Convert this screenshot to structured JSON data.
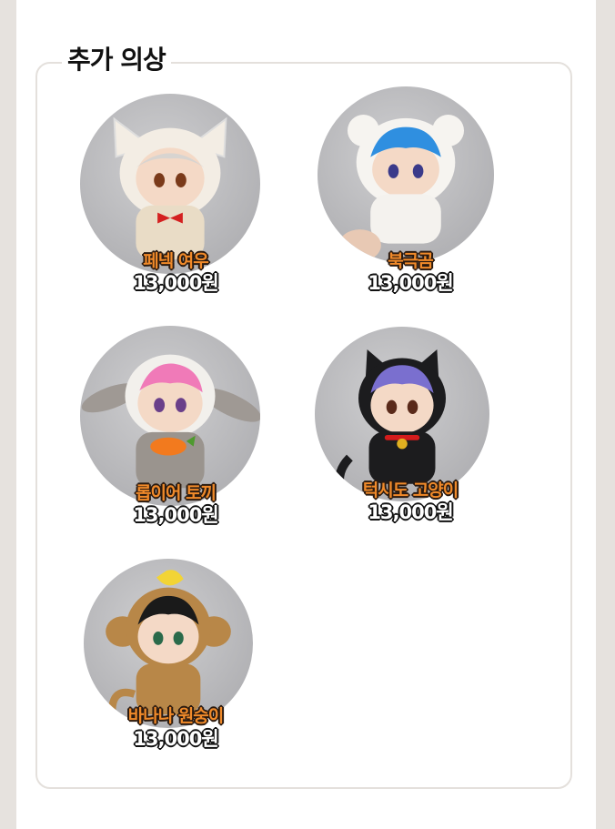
{
  "section": {
    "title": "추가 의상"
  },
  "products": [
    {
      "name": "페넥 여우",
      "price": "13,000원",
      "costume": "fennec-fox",
      "hair": "#d8d4d0",
      "suit": "#efe7da",
      "accent": "#d42020"
    },
    {
      "name": "북극곰",
      "price": "13,000원",
      "costume": "polar-bear",
      "hair": "#2f8fe0",
      "suit": "#f4f2ee",
      "accent": "#e8a9a0"
    },
    {
      "name": "롭이어 토끼",
      "price": "13,000원",
      "costume": "lop-rabbit",
      "hair": "#f07ab8",
      "suit": "#9a948e",
      "accent": "#f27a1e"
    },
    {
      "name": "턱시도 고양이",
      "price": "13,000원",
      "costume": "tuxedo-cat",
      "hair": "#7a6fcf",
      "suit": "#1c1c1e",
      "accent": "#d41c1c"
    },
    {
      "name": "바나나 원숭이",
      "price": "13,000원",
      "costume": "banana-monkey",
      "hair": "#1a1a1a",
      "suit": "#b88748",
      "accent": "#f2d435"
    }
  ]
}
